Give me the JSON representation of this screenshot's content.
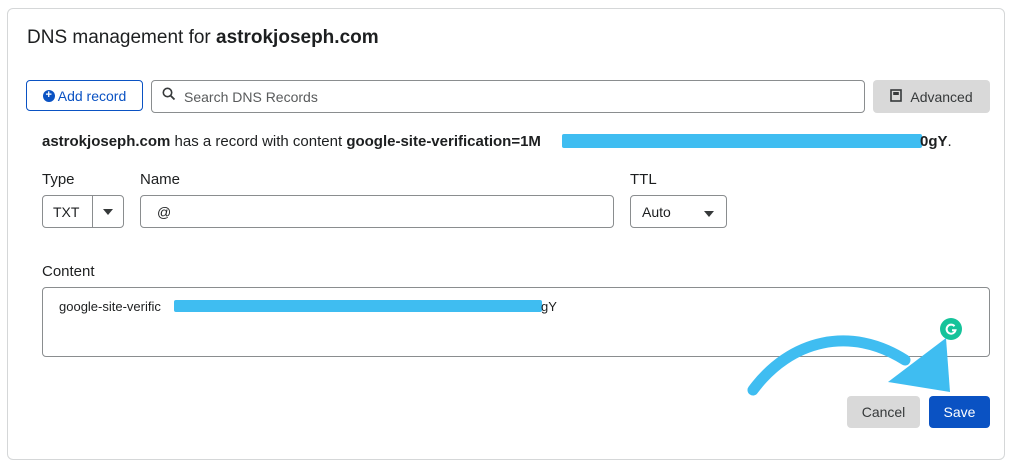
{
  "header": {
    "title_prefix": "DNS management for ",
    "domain": "astrokjoseph.com"
  },
  "toolbar": {
    "add_record_label": "Add record",
    "search_placeholder": "Search DNS Records",
    "advanced_label": "Advanced"
  },
  "record_message": {
    "domain": "astrokjoseph.com",
    "middle": " has a record with content ",
    "content_start": "google-site-verification=1M",
    "content_end": "0gY",
    "period": "."
  },
  "form": {
    "type_label": "Type",
    "type_value": "TXT",
    "name_label": "Name",
    "name_value": "@",
    "ttl_label": "TTL",
    "ttl_value": "Auto",
    "content_label": "Content",
    "content_start": "google-site-verific",
    "content_end": "gY"
  },
  "actions": {
    "cancel_label": "Cancel",
    "save_label": "Save"
  },
  "colors": {
    "primary": "#0a52c3",
    "redaction": "#3fbdf1",
    "annotation_arrow": "#3fbdf1",
    "grammarly": "#15c39a"
  },
  "icons": {
    "add": "plus-circle-icon",
    "search": "search-icon",
    "advanced": "book-icon",
    "dropdown": "caret-down-icon",
    "grammarly": "grammarly-icon",
    "annotation": "curved-arrow-icon"
  }
}
